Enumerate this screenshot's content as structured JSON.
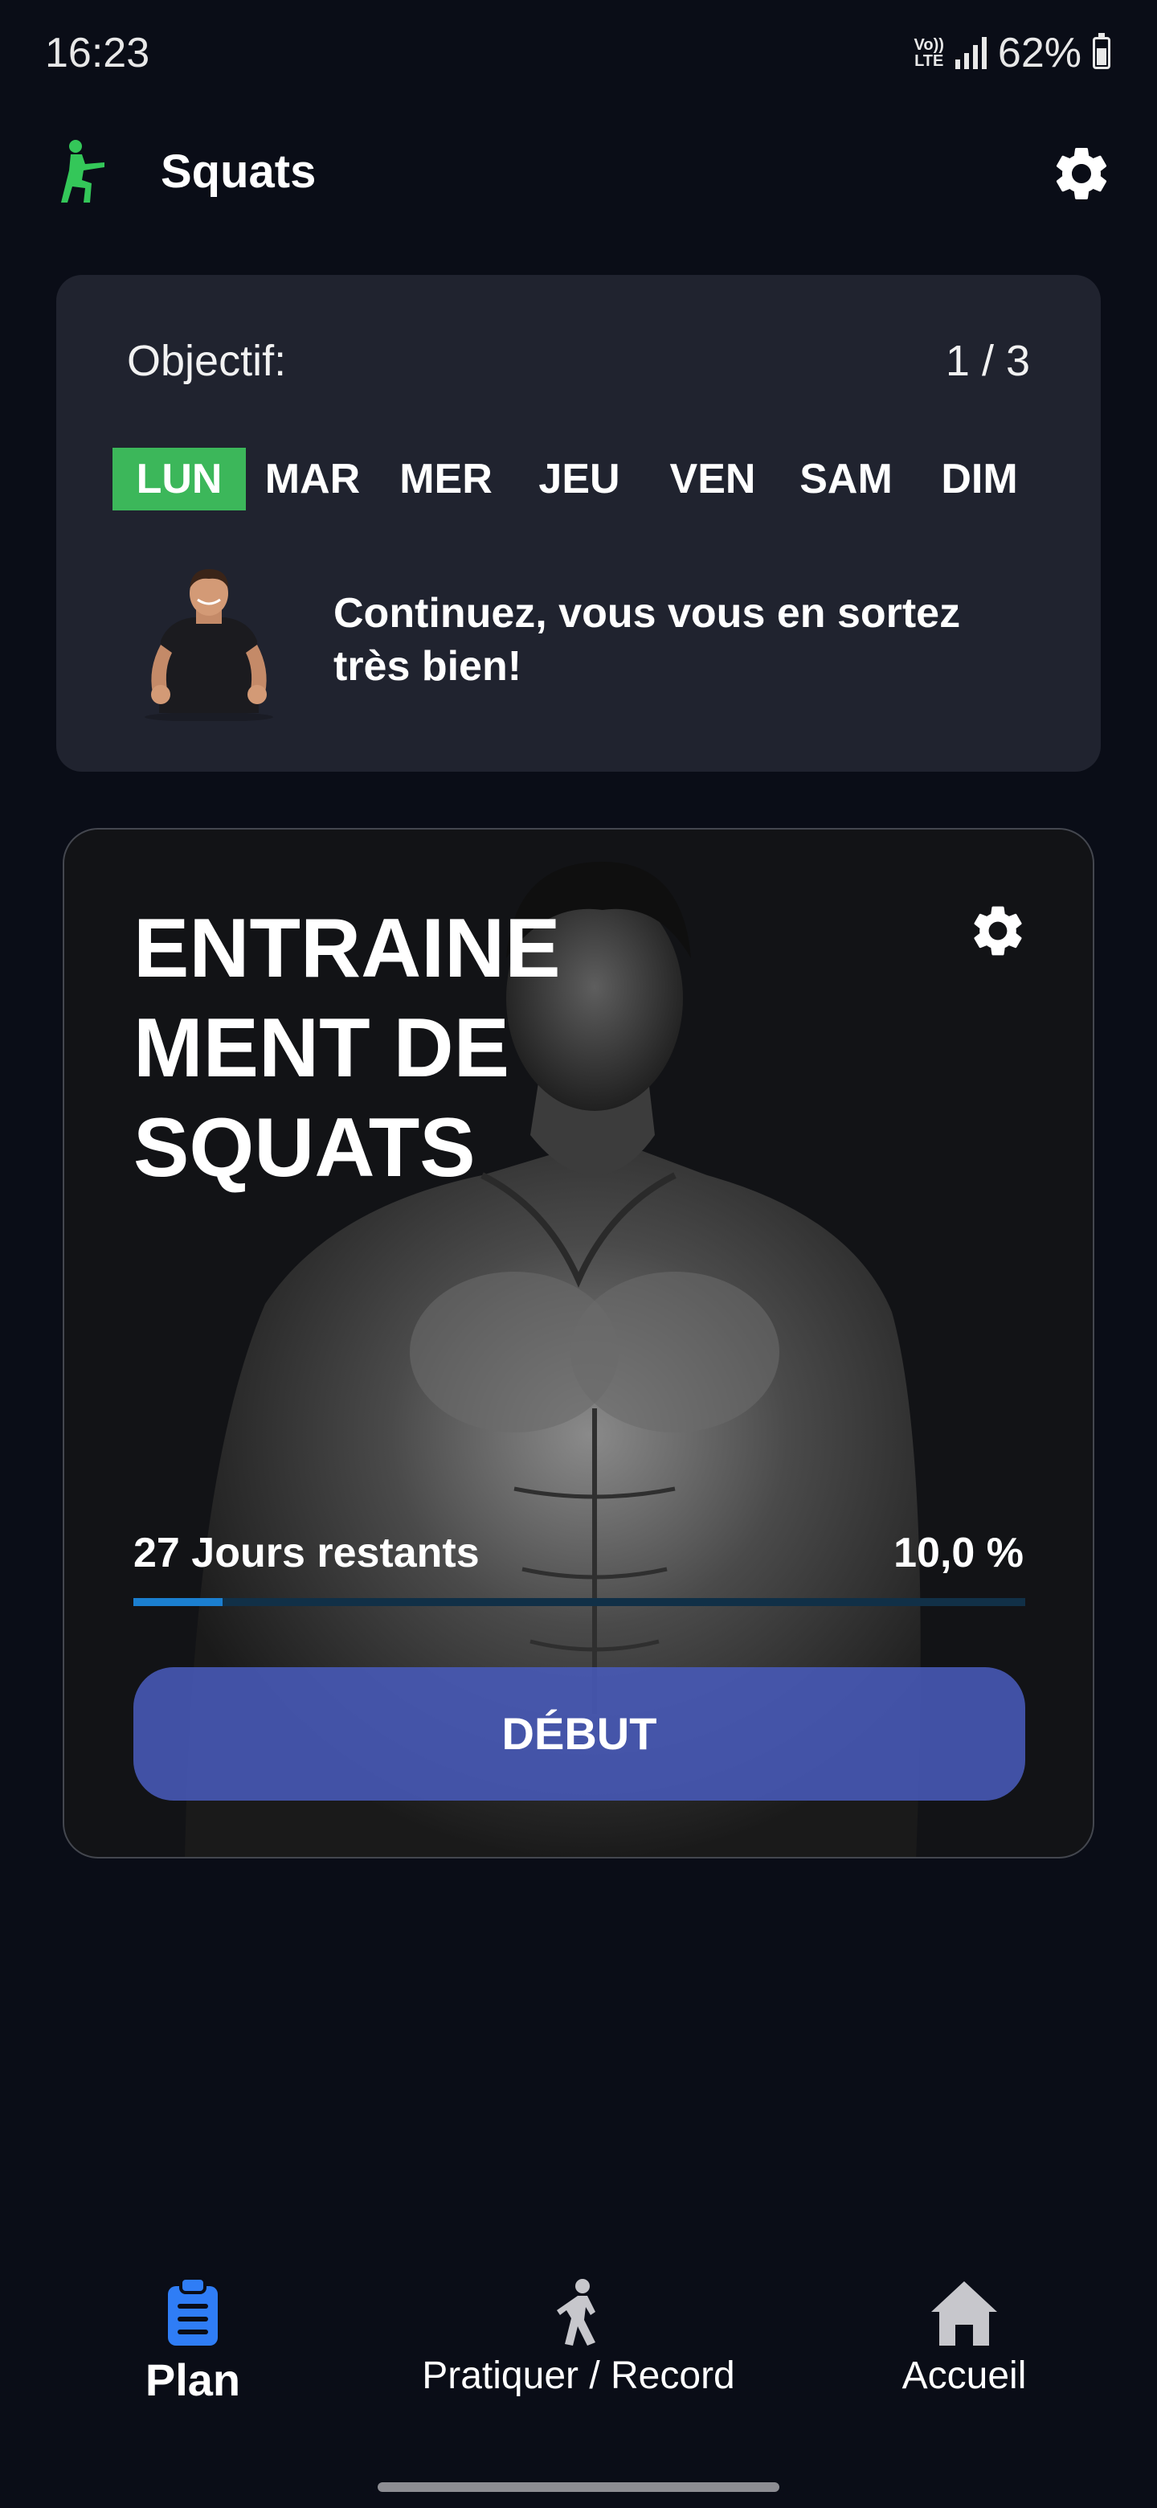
{
  "status_bar": {
    "time": "16:23",
    "volte_top": "Vo))",
    "volte_bottom": "LTE",
    "battery": "62%",
    "battery_level": 0.62
  },
  "app_bar": {
    "title": "Squats",
    "app_icon": "squat-figure-icon",
    "settings_icon": "gear-icon"
  },
  "goal": {
    "label": "Objectif:",
    "count": "1 / 3",
    "days": [
      "LUN",
      "MAR",
      "MER",
      "JEU",
      "VEN",
      "SAM",
      "DIM"
    ],
    "active_day": "LUN",
    "motivation": "Continuez, vous vous en sortez très bien!"
  },
  "workout": {
    "title": "ENTRAINE\nMENT DE\nSQUATS",
    "days_remaining": "27 Jours restants",
    "progress_label": "10,0 %",
    "progress": 0.1,
    "start_label": "DÉBUT",
    "settings_icon": "gear-icon"
  },
  "nav": {
    "plan": "Plan",
    "practice": "Pratiquer / Record",
    "home": "Accueil"
  },
  "colors": {
    "background": "#0a0d17",
    "card": "#20232f",
    "active_day": "#3cb75a",
    "accent_blue": "#2f7df6",
    "start_button": "#485ab9",
    "progress": "#1b7fd0"
  }
}
